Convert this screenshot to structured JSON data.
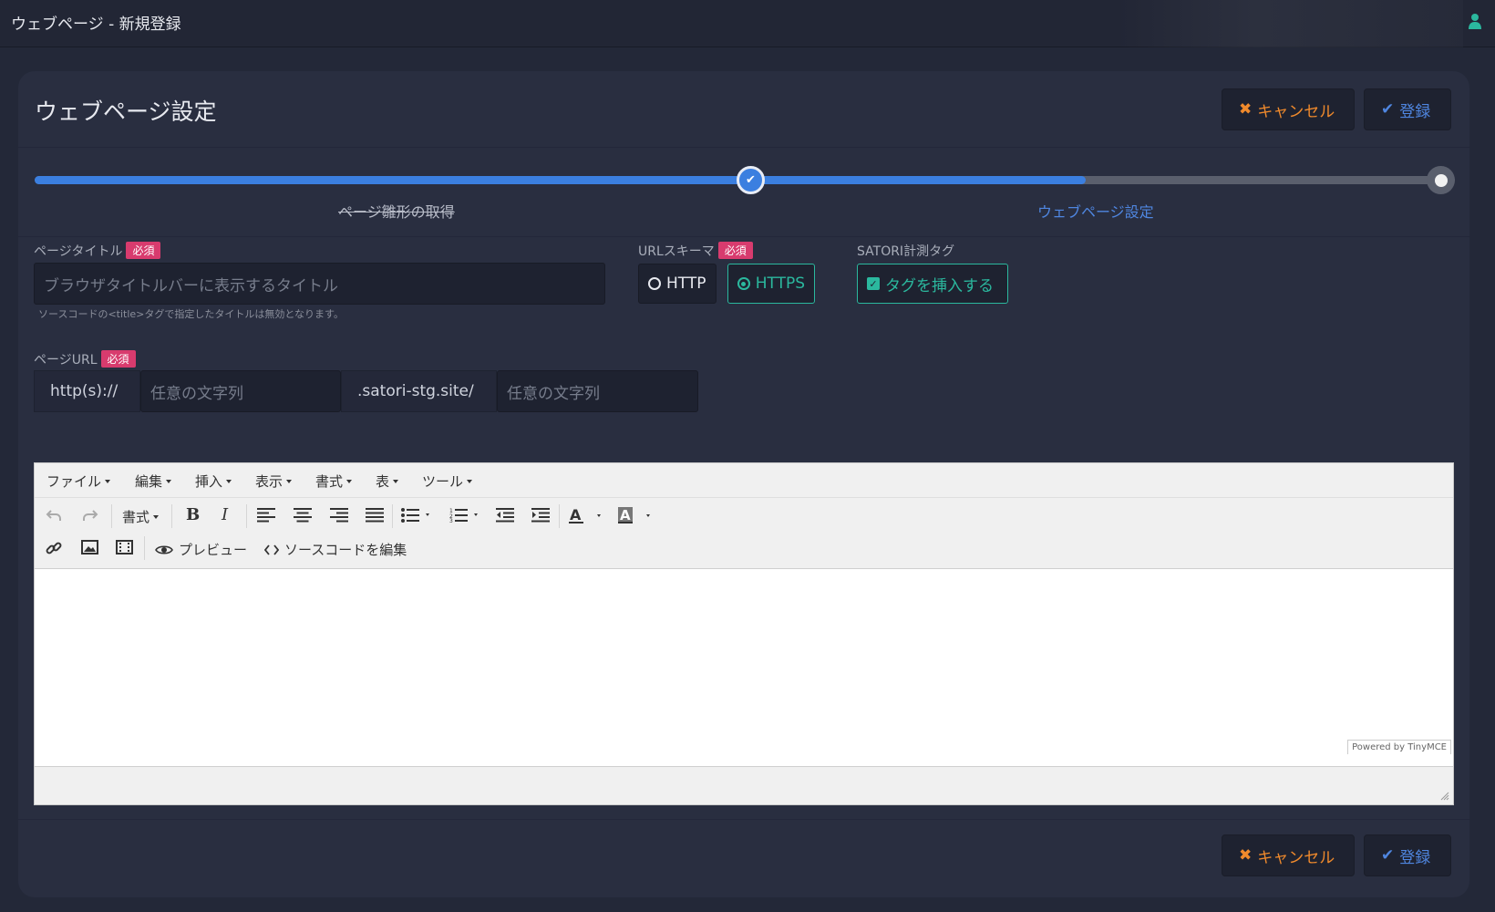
{
  "window": {
    "title": "ウェブページ - 新規登録"
  },
  "page": {
    "title": "ウェブページ設定"
  },
  "actions": {
    "cancel_label": "キャンセル",
    "submit_label": "登録"
  },
  "stepper": {
    "progress": 0.74,
    "steps": [
      {
        "label": "ページ雛形の取得",
        "state": "done"
      },
      {
        "label": "ウェブページ設定",
        "state": "current"
      }
    ]
  },
  "form": {
    "required_badge": "必須",
    "page_title": {
      "label": "ページタイトル",
      "placeholder": "ブラウザタイトルバーに表示するタイトル",
      "help": "ソースコードの<title>タグで指定したタイトルは無効となります。"
    },
    "url_scheme": {
      "label": "URLスキーマ",
      "options": [
        "HTTP",
        "HTTPS"
      ],
      "selected": "HTTPS"
    },
    "tracking_tag": {
      "label": "SATORI計測タグ",
      "checkbox_label": "タグを挿入する",
      "checked": true
    },
    "page_url": {
      "label": "ページURL",
      "prefix": "http(s)://",
      "subdomain_placeholder": "任意の文字列",
      "domain": ".satori-stg.site/",
      "path_placeholder": "任意の文字列"
    }
  },
  "editor": {
    "menus": [
      "ファイル",
      "編集",
      "挿入",
      "表示",
      "書式",
      "表",
      "ツール"
    ],
    "format_label": "書式",
    "preview_label": "プレビュー",
    "source_label": "ソースコードを編集",
    "powered_by": "Powered by TinyMCE",
    "content": ""
  },
  "colors": {
    "accent": "#3b7fe0",
    "cancel": "#f08a2c",
    "required": "#d83b6e",
    "success": "#2bb89e",
    "background": "#232838",
    "card": "#292e40"
  }
}
